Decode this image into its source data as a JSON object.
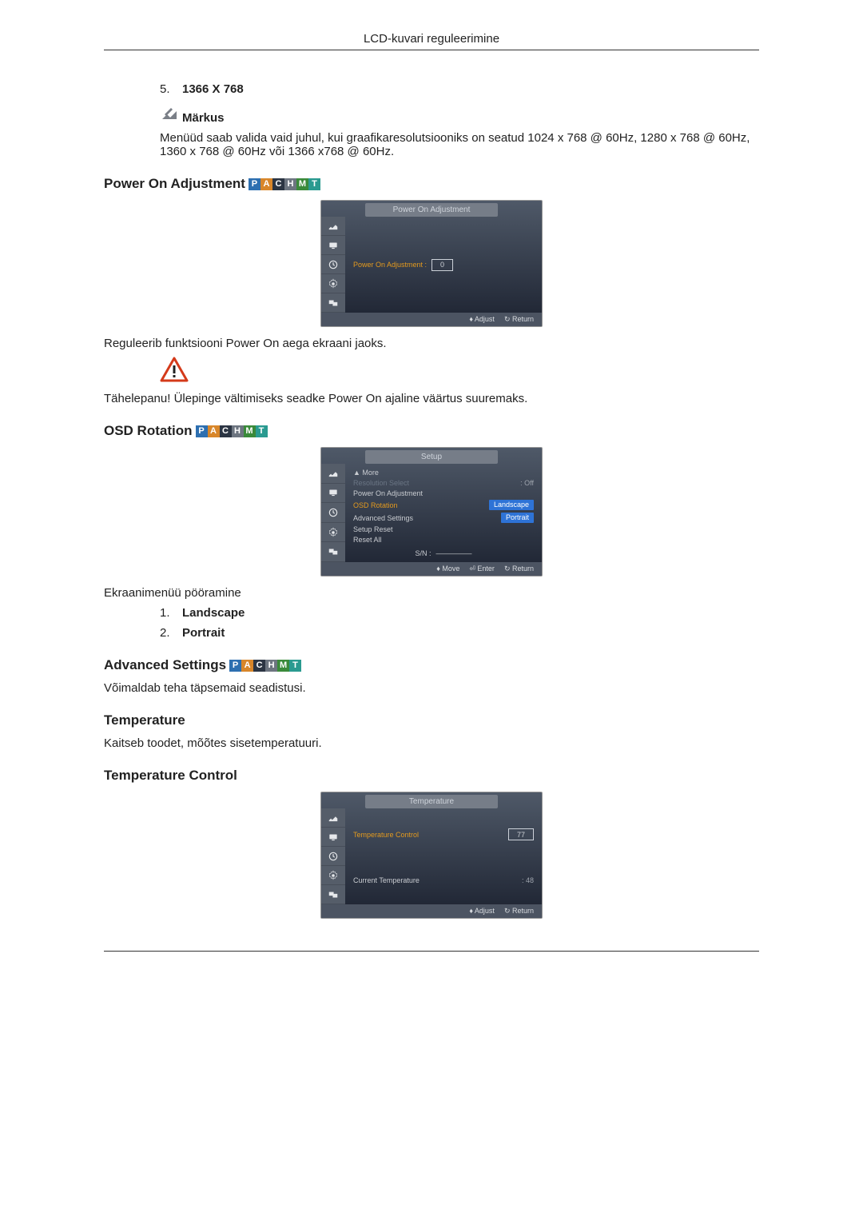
{
  "header": {
    "title": "LCD-kuvari reguleerimine"
  },
  "res_item": {
    "num": "5.",
    "label": "1366 X 768"
  },
  "note": {
    "label": "Märkus"
  },
  "note_text": "Menüüd saab valida vaid juhul, kui graafikaresolutsiooniks on seatud 1024 x 768 @ 60Hz, 1280 x 768 @ 60Hz, 1360 x 768 @ 60Hz või 1366 x768 @ 60Hz.",
  "pachmt": {
    "p": "P",
    "a": "A",
    "c": "C",
    "h": "H",
    "m": "M",
    "t": "T"
  },
  "power_on": {
    "title": "Power On Adjustment",
    "osd": {
      "menu_title": "Power On Adjustment",
      "label": "Power On Adjustment :",
      "value": "0",
      "footer_adjust": "♦ Adjust",
      "footer_return": "↻ Return"
    },
    "desc": "Reguleerib funktsiooni Power On aega ekraani jaoks.",
    "warning": "Tähelepanu! Ülepinge vältimiseks seadke Power On ajaline väärtus suuremaks."
  },
  "osd_rotation": {
    "title": "OSD Rotation",
    "osd": {
      "menu_title": "Setup",
      "more": "▲ More",
      "items": {
        "resolution": "Resolution Select",
        "resolution_val": ": Off",
        "power_on": "Power On Adjustment",
        "osd_rotation": "OSD Rotation",
        "landscape": "Landscape",
        "portrait": "Portrait",
        "advanced": "Advanced Settings",
        "setup_reset": "Setup Reset",
        "reset_all": "Reset All",
        "sn": "S/N :",
        "sn_val": "—————"
      },
      "footer_move": "♦ Move",
      "footer_enter": "⏎ Enter",
      "footer_return": "↻ Return"
    },
    "desc": "Ekraanimenüü pööramine",
    "list": {
      "n1": "1.",
      "l1": "Landscape",
      "n2": "2.",
      "l2": "Portrait"
    }
  },
  "advanced": {
    "title": "Advanced Settings",
    "desc": "Võimaldab teha täpsemaid seadistusi."
  },
  "temperature": {
    "title": "Temperature",
    "desc": "Kaitseb toodet, mõõtes sisetemperatuuri."
  },
  "temperature_control": {
    "title": "Temperature Control",
    "osd": {
      "menu_title": "Temperature",
      "tc_label": "Temperature Control",
      "tc_value": "77",
      "cur_label": "Current Temperature",
      "cur_value": ": 48",
      "footer_adjust": "♦ Adjust",
      "footer_return": "↻ Return"
    }
  }
}
